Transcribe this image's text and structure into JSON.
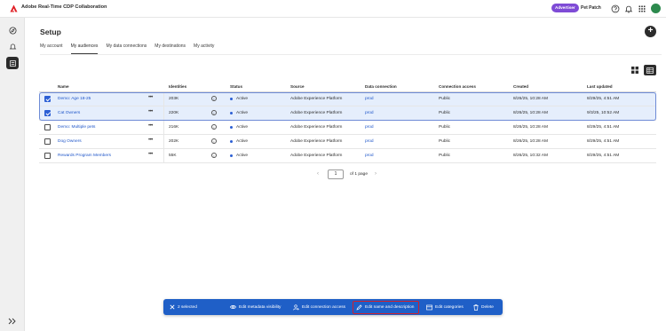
{
  "app": {
    "title": "Adobe Real-Time CDP Collaboration",
    "role_badge": "Advertiser",
    "org_name": "Pet Patch"
  },
  "colors": {
    "accent": "#1f5fc7",
    "link": "#1f56c9",
    "badge": "#7e4bd6",
    "selected_row": "#e5eefc",
    "highlight": "#d21f2b"
  },
  "topbar_icons": [
    "help-icon",
    "bell-icon",
    "app-grid-icon",
    "avatar"
  ],
  "rail_icons": [
    "compass-icon",
    "bell-icon",
    "setup-icon",
    "expand-icon"
  ],
  "page": {
    "title": "Setup",
    "tabs": [
      {
        "label": "My account",
        "selected": false
      },
      {
        "label": "My audiences",
        "selected": true
      },
      {
        "label": "My data connections",
        "selected": false
      },
      {
        "label": "My destinations",
        "selected": false
      },
      {
        "label": "My activity",
        "selected": false
      }
    ]
  },
  "table": {
    "columns": [
      "Name",
      "Identities",
      "Status",
      "Source",
      "Data connection",
      "Connection access",
      "Created",
      "Last updated"
    ],
    "rows": [
      {
        "selected": true,
        "name": "Demo: Age 18-25",
        "identities": "203K",
        "status": "Active",
        "source": "Adobe Experience Platform",
        "connection": "prod",
        "access": "Public",
        "created": "8/26/25, 10:28 AM",
        "updated": "8/29/25, 4:51 AM"
      },
      {
        "selected": true,
        "name": "Cat Owners",
        "identities": "220K",
        "status": "Active",
        "source": "Adobe Experience Platform",
        "connection": "prod",
        "access": "Public",
        "created": "8/26/25, 10:28 AM",
        "updated": "9/3/25, 10:52 AM"
      },
      {
        "selected": false,
        "name": "Demo: Multiple pets",
        "identities": "216K",
        "status": "Active",
        "source": "Adobe Experience Platform",
        "connection": "prod",
        "access": "Public",
        "created": "8/26/25, 10:28 AM",
        "updated": "8/29/25, 4:51 AM"
      },
      {
        "selected": false,
        "name": "Dog Owners",
        "identities": "202K",
        "status": "Active",
        "source": "Adobe Experience Platform",
        "connection": "prod",
        "access": "Public",
        "created": "8/26/25, 10:28 AM",
        "updated": "8/29/25, 4:51 AM"
      },
      {
        "selected": false,
        "name": "Rewards Program Members",
        "identities": "55K",
        "status": "Active",
        "source": "Adobe Experience Platform",
        "connection": "prod",
        "access": "Public",
        "created": "8/26/25, 10:32 AM",
        "updated": "8/29/25, 4:51 AM"
      }
    ]
  },
  "pagination": {
    "page": "1",
    "of_text": "of 1 page"
  },
  "action_bar": {
    "selected_text": "2 selected",
    "actions": [
      {
        "label": "Edit metadata visibility",
        "icon": "eye-icon"
      },
      {
        "label": "Edit connection access",
        "icon": "user-access-icon"
      },
      {
        "label": "Edit name and description",
        "icon": "pencil-icon",
        "highlighted": true
      },
      {
        "label": "Edit categories",
        "icon": "category-icon"
      },
      {
        "label": "Delete",
        "icon": "trash-icon"
      }
    ]
  }
}
